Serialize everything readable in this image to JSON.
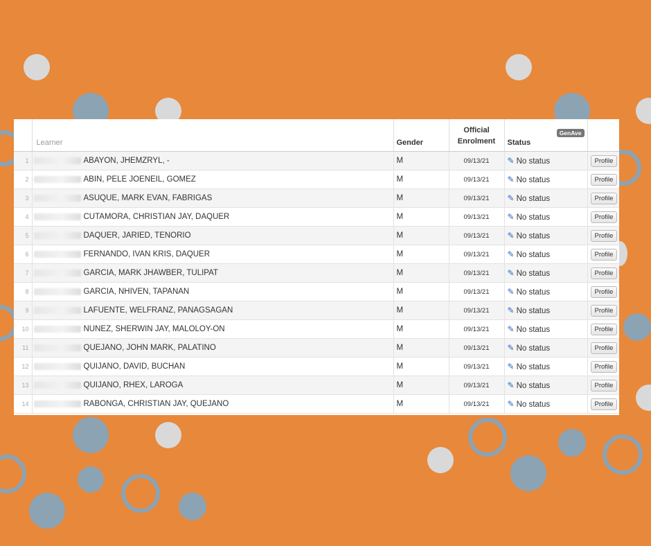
{
  "table": {
    "headers": {
      "learner": "Learner",
      "gender": "Gender",
      "enrolment": "Official\nEnrolment",
      "status": "Status",
      "genave": "GenAve"
    },
    "rows": [
      {
        "no": "1",
        "lrn": "1700XX170014",
        "name": "ABAYON, JHEMZRYL, -",
        "gender": "M",
        "date": "09/13/21",
        "status": "No status",
        "action": "Profile"
      },
      {
        "no": "2",
        "lrn": "",
        "name": "ABIN, PELE JOENEIL, GOMEZ",
        "gender": "M",
        "date": "09/13/21",
        "status": "No status",
        "action": "Profile"
      },
      {
        "no": "3",
        "lrn": "",
        "name": "ASUQUE, MARK EVAN, FABRIGAS",
        "gender": "M",
        "date": "09/13/21",
        "status": "No status",
        "action": "Profile"
      },
      {
        "no": "4",
        "lrn": "",
        "name": "CUTAMORA, CHRISTIAN JAY, DAQUER",
        "gender": "M",
        "date": "09/13/21",
        "status": "No status",
        "action": "Profile"
      },
      {
        "no": "5",
        "lrn": "",
        "name": "DAQUER, JARIED, TENORIO",
        "gender": "M",
        "date": "09/13/21",
        "status": "No status",
        "action": "Profile"
      },
      {
        "no": "6",
        "lrn": "",
        "name": "FERNANDO, IVAN KRIS, DAQUER",
        "gender": "M",
        "date": "09/13/21",
        "status": "No status",
        "action": "Profile"
      },
      {
        "no": "7",
        "lrn": "",
        "name": "GARCIA, MARK JHAWBER, TULIPAT",
        "gender": "M",
        "date": "09/13/21",
        "status": "No status",
        "action": "Profile"
      },
      {
        "no": "8",
        "lrn": "",
        "name": "GARCIA, NHIVEN, TAPANAN",
        "gender": "M",
        "date": "09/13/21",
        "status": "No status",
        "action": "Profile"
      },
      {
        "no": "9",
        "lrn": "",
        "name": "LAFUENTE, WELFRANZ, PANAGSAGAN",
        "gender": "M",
        "date": "09/13/21",
        "status": "No status",
        "action": "Profile"
      },
      {
        "no": "10",
        "lrn": "",
        "name": "NUNEZ, SHERWIN JAY, MALOLOY-ON",
        "gender": "M",
        "date": "09/13/21",
        "status": "No status",
        "action": "Profile"
      },
      {
        "no": "11",
        "lrn": "",
        "name": "QUEJANO, JOHN MARK, PALATINO",
        "gender": "M",
        "date": "09/13/21",
        "status": "No status",
        "action": "Profile"
      },
      {
        "no": "12",
        "lrn": "",
        "name": "QUIJANO, DAVID, BUCHAN",
        "gender": "M",
        "date": "09/13/21",
        "status": "No status",
        "action": "Profile"
      },
      {
        "no": "13",
        "lrn": "",
        "name": "QUIJANO, RHEX, LAROGA",
        "gender": "M",
        "date": "09/13/21",
        "status": "No status",
        "action": "Profile"
      },
      {
        "no": "14",
        "lrn": "",
        "name": "RABONGA, CHRISTIAN JAY, QUEJANO",
        "gender": "M",
        "date": "09/13/21",
        "status": "No status",
        "action": "Profile"
      }
    ]
  },
  "icons": {
    "status_edit": "pencil-icon"
  },
  "colors": {
    "background": "#E8883A",
    "dot_gray": "#D9D9D9",
    "dot_blue": "#8CA3B4",
    "pencil": "#2a6ebd"
  }
}
